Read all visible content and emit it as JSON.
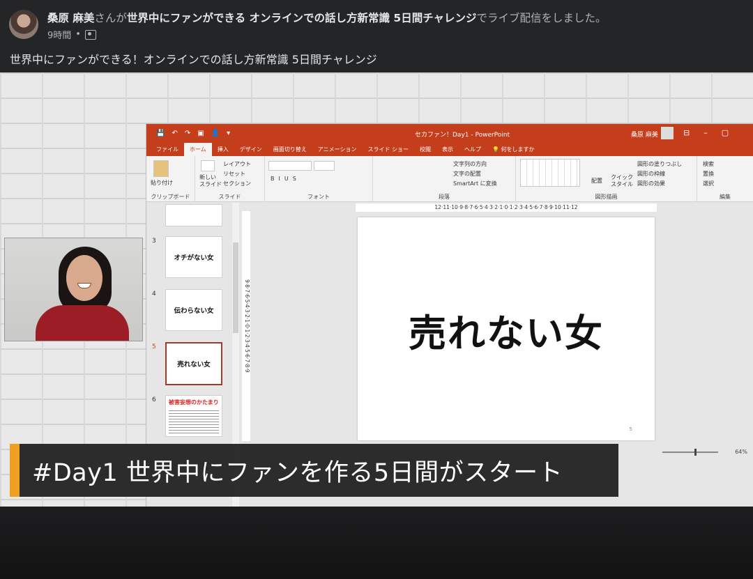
{
  "post": {
    "author": "桑原 麻美",
    "connector1": "さんが",
    "event_title": "世界中にファンができる オンラインでの話し方新常識 5日間チャレンジ",
    "connector2": "でライブ配信をしました。",
    "time": "9時間",
    "dot": "•",
    "privacy_icon": "group-icon",
    "text": "世界中にファンができる！オンラインでの話し方新常識 5日間チャレンジ"
  },
  "powerpoint": {
    "qat": [
      "💾",
      "↶",
      "↷",
      "▣",
      "👤",
      "▾"
    ],
    "doc_title": "セカファン！Day1  -  PowerPoint",
    "user": "桑原 麻美",
    "window_buttons": [
      "⊟",
      "–",
      "▢"
    ],
    "tabs": [
      "ファイル",
      "ホーム",
      "挿入",
      "デザイン",
      "画面切り替え",
      "アニメーション",
      "スライド ショー",
      "校閲",
      "表示",
      "ヘルプ",
      "💡 何をしますか"
    ],
    "active_tab": "ホーム",
    "ribbon": {
      "paste": "貼り付け",
      "clipboard": "クリップボード",
      "new_slide": "新しい\nスライド",
      "layout": "レイアウト",
      "reset": "リセット",
      "section": "セクション",
      "slides_group": "スライド",
      "font_group": "フォント",
      "paragraph_group": "段落",
      "text_direction": "文字列の方向",
      "align_text": "文字の配置",
      "smartart": "SmartArt に変換",
      "drawing_group": "図形描画",
      "arrange": "配置",
      "quick_style": "クイック\nスタイル",
      "fill": "図形の塗りつぶし",
      "outline": "図形の枠線",
      "effects": "図形の効果",
      "find": "検索",
      "replace": "置換",
      "select": "選択",
      "editing_group": "編集"
    },
    "ruler_h": "12·11·10·9·8·7·6·5·4·3·2·1·0·1·2·3·4·5·6·7·8·9·10·11·12",
    "ruler_v": "9·8·7·6·5·4·3·2·1·0·1·2·3·4·5·6·7·8·9",
    "thumbnails": [
      {
        "num": "3",
        "title": "オチがない女"
      },
      {
        "num": "4",
        "title": "伝わらない女"
      },
      {
        "num": "5",
        "title": "売れない女"
      },
      {
        "num": "6",
        "title": "被害妄想のかたまり"
      }
    ],
    "slide": {
      "title": "売れない女",
      "number": "5"
    },
    "zoom": "64%"
  },
  "caption": "#Day1 世界中にファンを作る5日間がスタート"
}
